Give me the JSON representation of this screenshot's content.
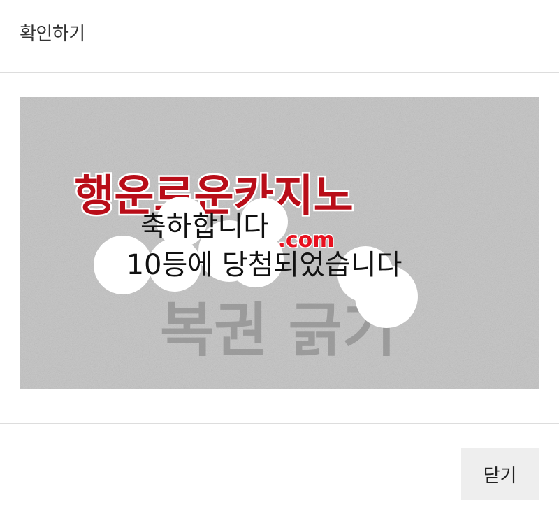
{
  "modal": {
    "title": "확인하기",
    "close_label": "닫기"
  },
  "scratch_card": {
    "logo_text": "행운로운카지노",
    "logo_domain": ".com",
    "cover_text": "복권 긁기",
    "revealed_text_line1": "축하합니다",
    "revealed_text_line2": "10등에 당첨되었습니다",
    "colors": {
      "cover": "#c8c8c8",
      "logo_red": "#e8101e",
      "scratched": "#ffffff"
    }
  }
}
